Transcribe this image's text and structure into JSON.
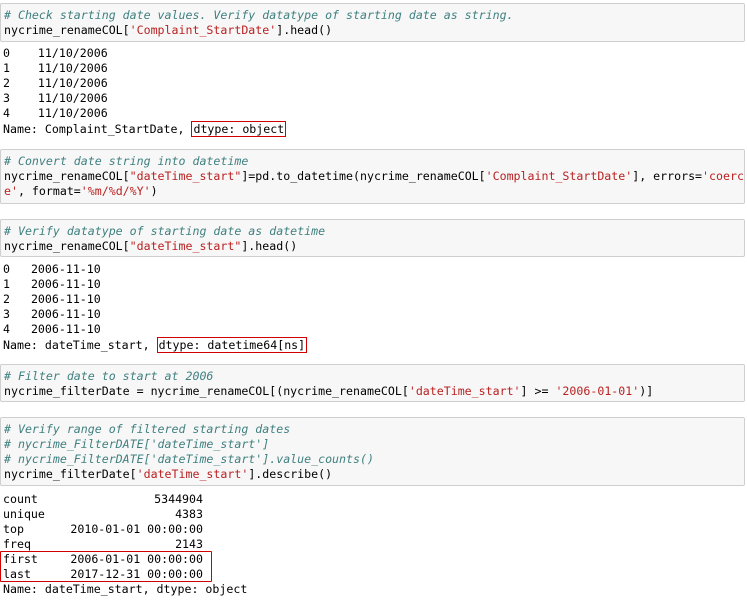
{
  "cell1": {
    "comment": "# Check starting date values. Verify datatype of starting date as string.",
    "code_pre": "nycrime_renameCOL[",
    "code_str": "'Complaint_StartDate'",
    "code_post": "].head()"
  },
  "out1": {
    "rows": [
      {
        "idx": "0",
        "val": "11/10/2006"
      },
      {
        "idx": "1",
        "val": "11/10/2006"
      },
      {
        "idx": "2",
        "val": "11/10/2006"
      },
      {
        "idx": "3",
        "val": "11/10/2006"
      },
      {
        "idx": "4",
        "val": "11/10/2006"
      }
    ],
    "name_prefix": "Name: Complaint_StartDate, ",
    "dtype": "dtype: object"
  },
  "cell2": {
    "comment": "# Convert date string into datetime",
    "l1_a": "nycrime_renameCOL[",
    "l1_b": "\"dateTime_start\"",
    "l1_c": "]=pd.to_datetime(nycrime_renameCOL[",
    "l1_d": "'Complaint_StartDate'",
    "l1_e": "], errors=",
    "l1_f": "'coerc",
    "l2_a": "e'",
    "l2_b": ", format=",
    "l2_c": "'%m/%d/%Y'",
    "l2_d": ")"
  },
  "cell3": {
    "comment": "# Verify datatype of starting date as datetime",
    "code_pre": "nycrime_renameCOL[",
    "code_str": "\"dateTime_start\"",
    "code_post": "].head()"
  },
  "out3": {
    "rows": [
      {
        "idx": "0",
        "val": "2006-11-10"
      },
      {
        "idx": "1",
        "val": "2006-11-10"
      },
      {
        "idx": "2",
        "val": "2006-11-10"
      },
      {
        "idx": "3",
        "val": "2006-11-10"
      },
      {
        "idx": "4",
        "val": "2006-11-10"
      }
    ],
    "name_prefix": "Name: dateTime_start, ",
    "dtype": "dtype: datetime64[ns]"
  },
  "cell4": {
    "comment": "# Filter date to start at 2006",
    "a": "nycrime_filterDate = nycrime_renameCOL[(nycrime_renameCOL[",
    "b": "'dateTime_start'",
    "c": "] ",
    "d": ">=",
    "e": " ",
    "f": "'2006-01-01'",
    "g": ")]"
  },
  "cell5": {
    "comment1": "# Verify range of filtered starting dates",
    "comment2": "# nycrime_FilterDATE['dateTime_start']",
    "comment3": "# nycrime_FilterDATE['dateTime_start'].value_counts()",
    "code_pre": "nycrime_filterDate[",
    "code_str": "'dateTime_start'",
    "code_post": "].describe()"
  },
  "out5": {
    "rows": [
      {
        "key": "count",
        "val": "5344904"
      },
      {
        "key": "unique",
        "val": "4383"
      },
      {
        "key": "top",
        "val": "2010-01-01 00:00:00"
      },
      {
        "key": "freq",
        "val": "2143"
      },
      {
        "key": "first",
        "val": "2006-01-01 00:00:00"
      },
      {
        "key": "last",
        "val": "2017-12-31 00:00:00"
      }
    ],
    "footer": "Name: dateTime_start, dtype: object"
  }
}
